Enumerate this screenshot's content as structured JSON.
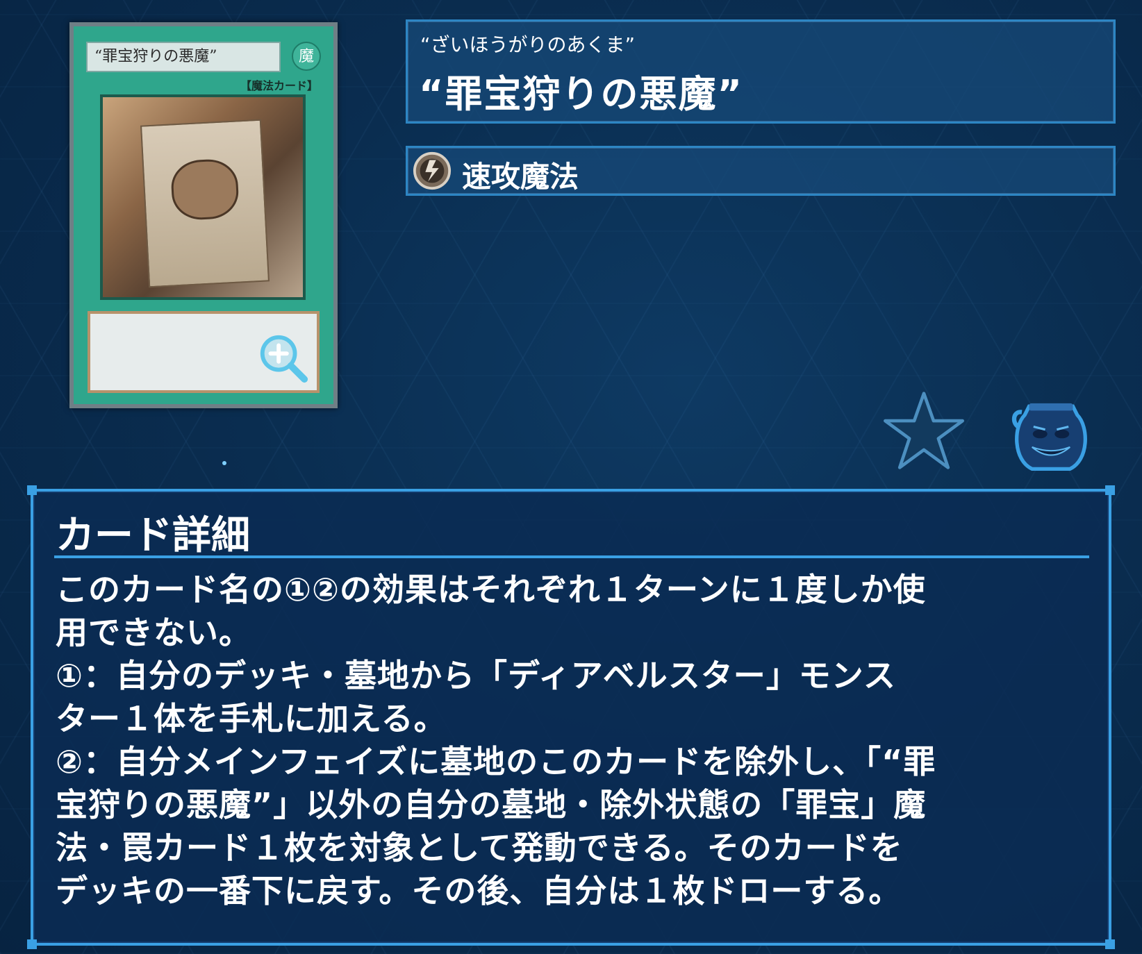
{
  "card": {
    "name_plate": "“罪宝狩りの悪魔”",
    "attribute_glyph": "魔",
    "type_line": "【魔法カード】",
    "zoom_icon": "magnifier-plus-icon"
  },
  "header": {
    "ruby": "“ざいほうがりのあくま”",
    "title": "“罪宝狩りの悪魔”",
    "spell_type_icon": "quick-play-spell-icon",
    "spell_type": "速攻魔法"
  },
  "actions": {
    "favorite_icon": "star-icon",
    "pot_icon": "pot-of-greed-icon"
  },
  "detail": {
    "heading": "カード詳細",
    "lines": [
      "このカード名の①②の効果はそれぞれ１ターンに１度しか使",
      "用できない。",
      "①：自分のデッキ・墓地から「ディアベルスター」モンス",
      "ター１体を手札に加える。",
      "②：自分メインフェイズに墓地のこのカードを除外し、「“罪",
      "宝狩りの悪魔”」以外の自分の墓地・除外状態の「罪宝」魔",
      "法・罠カード１枚を対象として発動できる。そのカードを",
      "デッキの一番下に戻す。その後、自分は１枚ドローする。"
    ]
  },
  "colors": {
    "background": "#0a2d50",
    "panel_border": "#3aa0e4",
    "card_frame": "#2fa68c"
  }
}
